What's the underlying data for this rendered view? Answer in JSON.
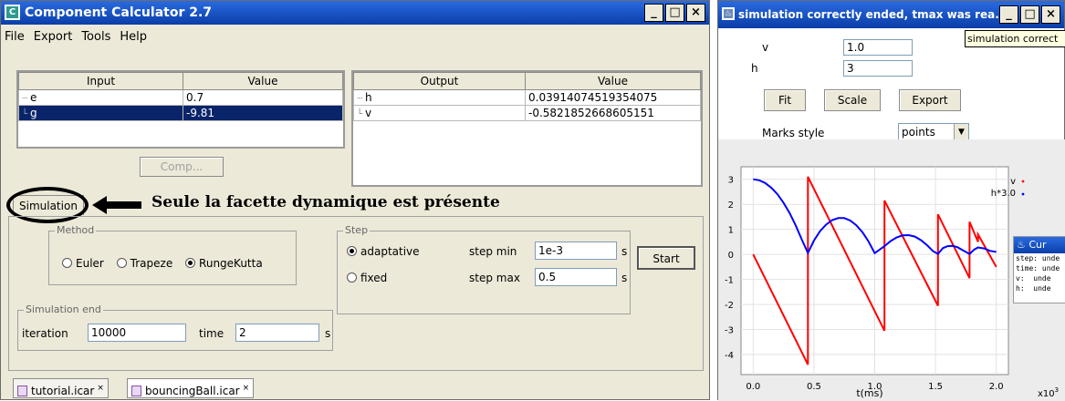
{
  "calc": {
    "title": "Component Calculator 2.7",
    "btn_min": "_",
    "btn_max": "□",
    "btn_close": "×",
    "menu": [
      "File",
      "Export",
      "Tools",
      "Help"
    ],
    "inputs": {
      "col_input": "Input",
      "col_value": "Value",
      "rows": [
        {
          "name": "e",
          "value": "0.7"
        },
        {
          "name": "g",
          "value": "-9.81"
        }
      ]
    },
    "outputs": {
      "col_output": "Output",
      "col_value": "Value",
      "rows": [
        {
          "name": "h",
          "value": "0.03914074519354075"
        },
        {
          "name": "v",
          "value": "-0.5821852668605151"
        }
      ]
    },
    "comp_button": "Comp...",
    "sim_tab": "Simulation",
    "annotation": "Seule la facette dynamique est présente",
    "method": {
      "title": "Method",
      "options": [
        "Euler",
        "Trapeze",
        "RungeKutta"
      ]
    },
    "step": {
      "title": "Step",
      "adaptative": "adaptative",
      "fixed": "fixed",
      "step_min_label": "step min",
      "step_min": "1e-3",
      "step_max_label": "step max",
      "step_max": "0.5",
      "unit": "s"
    },
    "start_button": "Start",
    "sim_end": {
      "title": "Simulation end",
      "iteration_label": "iteration",
      "iteration": "10000",
      "time_label": "time",
      "time": "2",
      "unit": "s"
    },
    "tabs": [
      "tutorial.icar",
      "bouncingBall.icar"
    ],
    "tab_close": "×"
  },
  "sim": {
    "title": "simulation correctly ended, tmax was rea...",
    "tooltip": "simulation correct",
    "v_label": "v",
    "v_value": "1.0",
    "h_label": "h",
    "h_value": "3",
    "fit": "Fit",
    "scale": "Scale",
    "export": "Export",
    "marks_label": "Marks style",
    "marks_value": "points",
    "legend": [
      {
        "name": "v",
        "color": "#ff0000"
      },
      {
        "name": "h*3.0",
        "color": "#0000ff"
      }
    ],
    "xlabel": "t(ms)",
    "xexp": "x10",
    "xexp_power": "3",
    "mini": {
      "title": "Cur",
      "lines": [
        [
          "step:",
          "unde"
        ],
        [
          "time:",
          "unde"
        ],
        [
          "v:",
          "unde"
        ],
        [
          "h:",
          "unde"
        ]
      ]
    }
  },
  "chart_data": {
    "type": "line",
    "xlabel": "t(ms)",
    "ylabel": "",
    "xlim": [
      -0.1,
      2.1
    ],
    "ylim": [
      -4.8,
      3.5
    ],
    "xticks": [
      "0.0",
      "0.5",
      "1.0",
      "1.5",
      "2.0"
    ],
    "yticks": [
      "3",
      "2",
      "1",
      "0",
      "-1",
      "-2",
      "-3",
      "-4"
    ],
    "series": [
      {
        "name": "v",
        "color": "#ff0000",
        "x": [
          0,
          0.45,
          0.45,
          0.45,
          1.08,
          1.08,
          1.52,
          1.52,
          1.78,
          1.78,
          1.85,
          1.85,
          2.0
        ],
        "y": [
          0,
          -4.4,
          -4.4,
          3.1,
          -3.05,
          2.15,
          -2.05,
          1.6,
          -0.95,
          1.3,
          0.5,
          0.8,
          -0.5
        ]
      },
      {
        "name": "h*3.0",
        "color": "#0000ff",
        "x": [
          0,
          0.05,
          0.1,
          0.15,
          0.2,
          0.25,
          0.3,
          0.35,
          0.4,
          0.45,
          0.5,
          0.55,
          0.6,
          0.65,
          0.7,
          0.75,
          0.8,
          0.85,
          0.9,
          0.95,
          1.0,
          1.08,
          1.13,
          1.18,
          1.23,
          1.28,
          1.33,
          1.38,
          1.43,
          1.48,
          1.52,
          1.56,
          1.6,
          1.64,
          1.68,
          1.72,
          1.78,
          1.82,
          1.85,
          1.9,
          1.95,
          2.0
        ],
        "y": [
          3,
          2.96,
          2.85,
          2.66,
          2.4,
          2.06,
          1.65,
          1.16,
          0.59,
          0.06,
          0.55,
          0.93,
          1.19,
          1.37,
          1.45,
          1.45,
          1.35,
          1.16,
          0.88,
          0.51,
          0.05,
          0.33,
          0.53,
          0.68,
          0.76,
          0.77,
          0.71,
          0.57,
          0.37,
          0.13,
          0.02,
          0.25,
          0.33,
          0.34,
          0.29,
          0.18,
          0.02,
          0.2,
          0.28,
          0.24,
          0.14,
          0.1
        ]
      }
    ]
  }
}
